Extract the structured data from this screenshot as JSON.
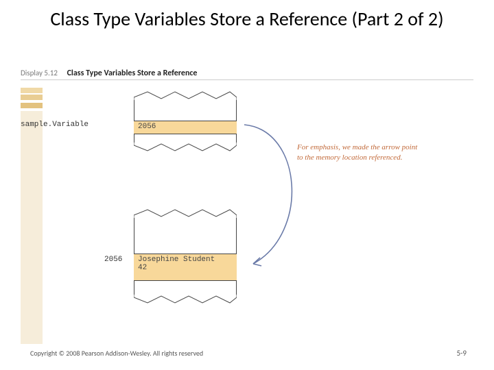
{
  "title": "Class Type Variables Store a Reference (Part 2 of 2)",
  "display": {
    "label": "Display 5.12",
    "caption": "Class Type Variables Store a Reference"
  },
  "diagram": {
    "var_name": "sample.Variable",
    "ref_value": "2056",
    "mem_addr": "2056",
    "obj_line1": "Josephine Student",
    "obj_line2": "42",
    "annotation": "For emphasis, we made the arrow point to the memory location referenced."
  },
  "footer": {
    "copyright": "Copyright © 2008 Pearson Addison-Wesley. All rights reserved",
    "page": "5-9"
  }
}
